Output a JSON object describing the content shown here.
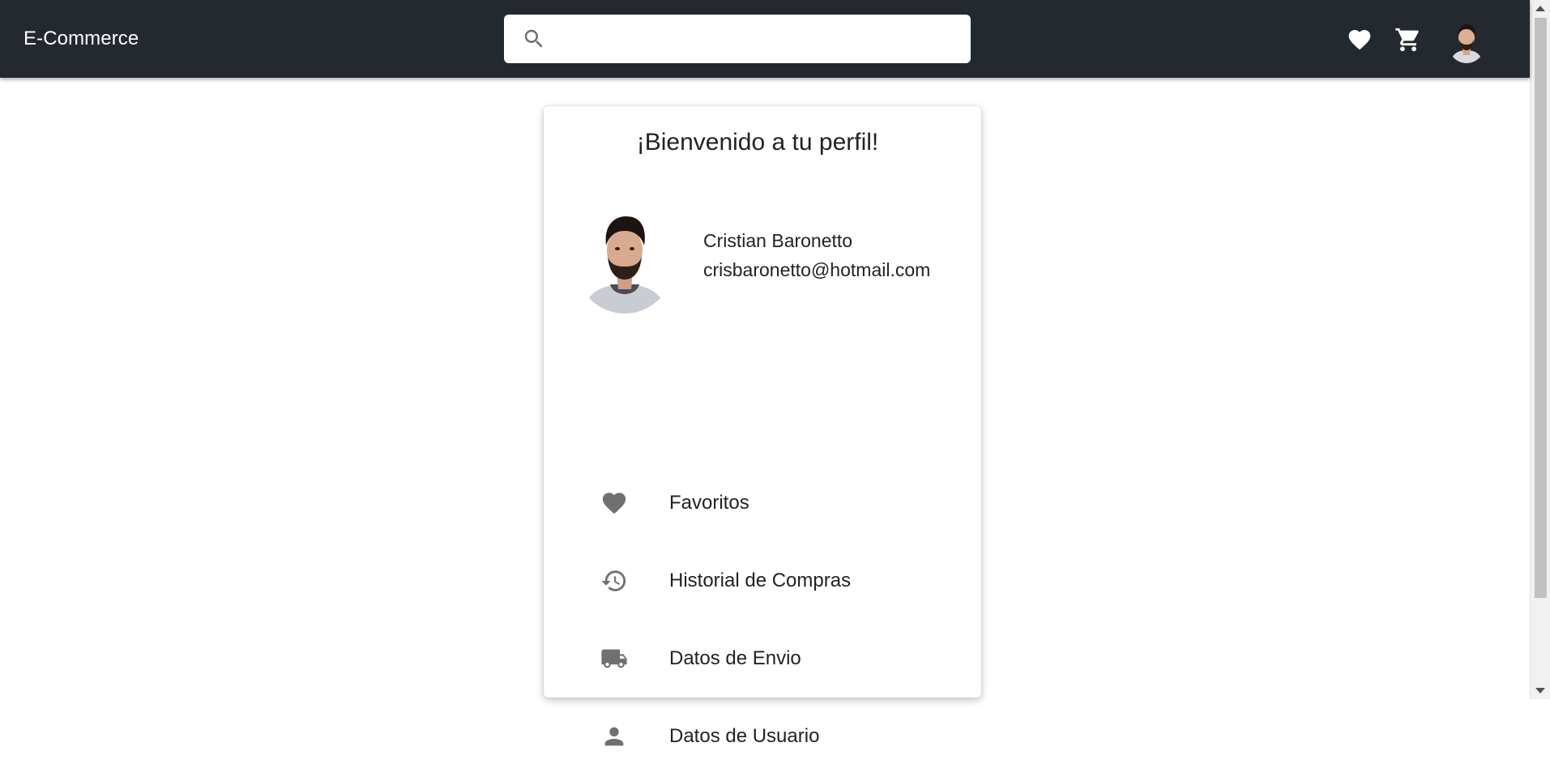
{
  "header": {
    "brand": "E-Commerce",
    "search": {
      "value": "",
      "placeholder": ""
    },
    "icons": [
      "search-icon",
      "heart-icon",
      "cart-icon",
      "avatar"
    ]
  },
  "profile": {
    "title": "¡Bienvenido a tu perfil!",
    "name": "Cristian Baronetto",
    "email": "crisbaronetto@hotmail.com"
  },
  "menu": [
    {
      "label": "Favoritos",
      "icon": "heart-icon"
    },
    {
      "label": "Historial de Compras",
      "icon": "history-icon"
    },
    {
      "label": "Datos de Envio",
      "icon": "truck-icon"
    },
    {
      "label": "Datos de Usuario",
      "icon": "person-icon"
    }
  ],
  "colors": {
    "app_bar": "#24282f",
    "icon_gray": "#707070",
    "text": "#222222"
  }
}
